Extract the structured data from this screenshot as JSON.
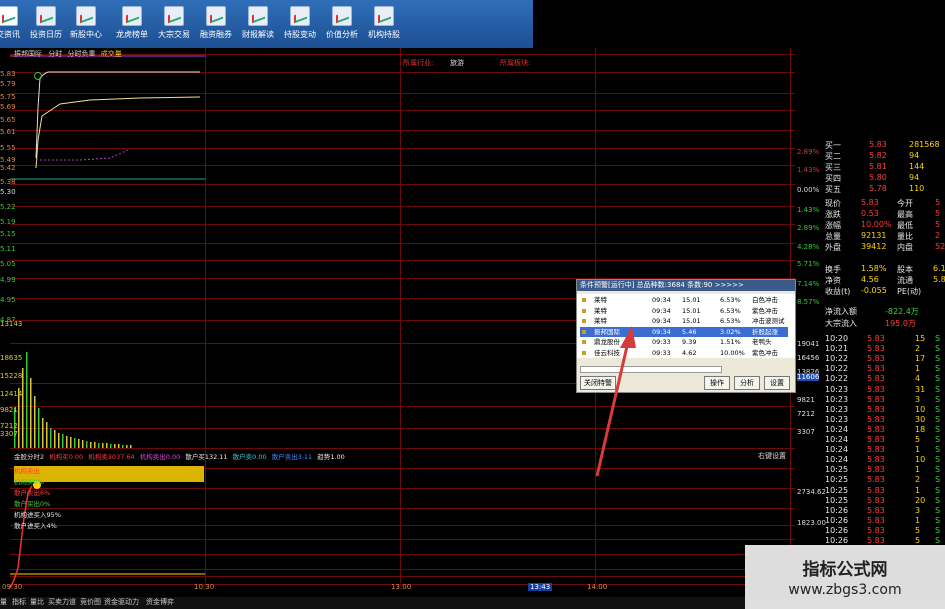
{
  "toolbar": {
    "items": [
      "交资讯",
      "投资日历",
      "新股中心",
      "龙虎榜单",
      "大宗交易",
      "融资融券",
      "财报解读",
      "持股变动",
      "价值分析",
      "机构持股"
    ]
  },
  "chart_header": {
    "stock": "振邦国际",
    "tab1": "分时",
    "tab2": "分时负重",
    "tab3": "成交量",
    "industry_label": "所属行业:",
    "industry_value": "旅游",
    "region_label": "所属板块:"
  },
  "price_axis_left": [
    "5.83",
    "5.79",
    "5.75",
    "5.69",
    "5.65",
    "5.61",
    "5.55",
    "5.49",
    "5.42",
    "5.38",
    "5.30",
    "5.22",
    "5.19",
    "5.15",
    "5.11",
    "5.05",
    "4.99",
    "4.95",
    "4.87"
  ],
  "pct_axis_right": [
    "2.89%",
    "1.43%",
    "0.00%",
    "1.43%",
    "2.89%",
    "4.28%",
    "5.71%",
    "7.14%",
    "8.57%"
  ],
  "volume_axis_left": [
    "13143",
    "18635",
    "15228",
    "12414",
    "9821",
    "7212",
    "3307"
  ],
  "volume_axis_right": [
    "19041",
    "16456",
    "13826",
    "11606",
    "9821",
    "7212",
    "3307"
  ],
  "indicator_header": {
    "name": "金股分时2",
    "fields": [
      "机构买",
      "机构卖",
      "机构卖出",
      "散户买",
      "散户卖",
      "散户卖出",
      "趋势"
    ],
    "values": [
      "0.00",
      "3037.64",
      "0.00",
      "132.11",
      "0.00",
      "3.11",
      "1.00"
    ],
    "right_label": "右键设置"
  },
  "indicator_legend": [
    "机构卖出",
    "机构买0%",
    "散户卖出6%",
    "散户买出0%",
    "机构进买入95%",
    "散户进买入4%"
  ],
  "indicator_axis": [
    "2734.62",
    "1823.00"
  ],
  "time_axis": [
    "09:30",
    "10:30",
    "13:00",
    "13:43",
    "14:00"
  ],
  "quote_panel": {
    "bids": [
      {
        "label": "买一",
        "price": "5.83",
        "vol": "281568"
      },
      {
        "label": "买二",
        "price": "5.82",
        "vol": "94"
      },
      {
        "label": "买三",
        "price": "5.81",
        "vol": "144"
      },
      {
        "label": "买四",
        "price": "5.80",
        "vol": "94"
      },
      {
        "label": "买五",
        "price": "5.78",
        "vol": "110"
      }
    ],
    "stats": [
      {
        "l1": "现价",
        "v1": "5.83",
        "l2": "今开",
        "v2": "5"
      },
      {
        "l1": "涨跌",
        "v1": "0.53",
        "l2": "最高",
        "v2": "5"
      },
      {
        "l1": "涨幅",
        "v1": "10.00%",
        "l2": "最低",
        "v2": "5"
      },
      {
        "l1": "总量",
        "v1": "92131",
        "l2": "量比",
        "v2": "2"
      },
      {
        "l1": "外盘",
        "v1": "39412",
        "l2": "内盘",
        "v2": "527"
      }
    ],
    "stats2": [
      {
        "l1": "换手",
        "v1": "1.58%",
        "l2": "股本",
        "v2": "6.1"
      },
      {
        "l1": "净资",
        "v1": "4.56",
        "l2": "流通",
        "v2": "5.8"
      },
      {
        "l1": "收益(t)",
        "v1": "-0.055",
        "l2": "PE(动)",
        "v2": ""
      }
    ],
    "flow": [
      {
        "label": "净流入额",
        "value": "-822.4万"
      },
      {
        "label": "大宗流入",
        "value": "195.0万"
      }
    ],
    "ticks": [
      {
        "t": "10:20",
        "p": "5.83",
        "v": "15",
        "s": "S"
      },
      {
        "t": "10:21",
        "p": "5.83",
        "v": "2",
        "s": "S"
      },
      {
        "t": "10:22",
        "p": "5.83",
        "v": "17",
        "s": "S"
      },
      {
        "t": "10:22",
        "p": "5.83",
        "v": "1",
        "s": "S"
      },
      {
        "t": "10:22",
        "p": "5.83",
        "v": "4",
        "s": "S"
      },
      {
        "t": "10:23",
        "p": "5.83",
        "v": "31",
        "s": "S"
      },
      {
        "t": "10:23",
        "p": "5.83",
        "v": "3",
        "s": "S"
      },
      {
        "t": "10:23",
        "p": "5.83",
        "v": "10",
        "s": "S"
      },
      {
        "t": "10:23",
        "p": "5.83",
        "v": "30",
        "s": "S"
      },
      {
        "t": "10:24",
        "p": "5.83",
        "v": "18",
        "s": "S"
      },
      {
        "t": "10:24",
        "p": "5.83",
        "v": "5",
        "s": "S"
      },
      {
        "t": "10:24",
        "p": "5.83",
        "v": "1",
        "s": "S"
      },
      {
        "t": "10:24",
        "p": "5.83",
        "v": "10",
        "s": "S"
      },
      {
        "t": "10:25",
        "p": "5.83",
        "v": "1",
        "s": "S"
      },
      {
        "t": "10:25",
        "p": "5.83",
        "v": "2",
        "s": "S"
      },
      {
        "t": "10:25",
        "p": "5.83",
        "v": "1",
        "s": "S"
      },
      {
        "t": "10:25",
        "p": "5.83",
        "v": "20",
        "s": "S"
      },
      {
        "t": "10:26",
        "p": "5.83",
        "v": "3",
        "s": "S"
      },
      {
        "t": "10:26",
        "p": "5.83",
        "v": "1",
        "s": "S"
      },
      {
        "t": "10:26",
        "p": "5.83",
        "v": "5",
        "s": "S"
      },
      {
        "t": "10:26",
        "p": "5.83",
        "v": "5",
        "s": "S"
      }
    ]
  },
  "popup": {
    "title": "条件预警[运行中] 总品种数:3684 条数:90 >>>>>",
    "rows": [
      {
        "name": "莱特",
        "time": "09:34",
        "price": "15.01",
        "pct": "6.53%",
        "cond": "白色冲击"
      },
      {
        "name": "莱特",
        "time": "09:34",
        "price": "15.01",
        "pct": "6.53%",
        "cond": "紫色冲击"
      },
      {
        "name": "莱特",
        "time": "09:34",
        "price": "15.01",
        "pct": "6.53%",
        "cond": "冲击波测试"
      },
      {
        "name": "振邦国际",
        "time": "09:34",
        "price": "5.46",
        "pct": "3.02%",
        "cond": "折股起涨"
      },
      {
        "name": "鼎龙股份",
        "time": "09:33",
        "price": "9.39",
        "pct": "1.51%",
        "cond": "老鸭头"
      },
      {
        "name": "佳云科技",
        "time": "09:33",
        "price": "4.62",
        "pct": "10.00%",
        "cond": "紫色冲击"
      }
    ],
    "close_btn": "关闭特警",
    "btn_op": "操作",
    "btn_analyze": "分析",
    "btn_settings": "设置"
  },
  "bottom_tabs": [
    "量",
    "指标",
    "量比",
    "买卖力道",
    "竞价图",
    "资金驱动力",
    "资金博弈"
  ],
  "watermark": {
    "title": "指标公式网",
    "url": "www.zbgs3.com"
  },
  "colors": {
    "red": "#ff3b3b",
    "green": "#3fd13f",
    "grid": "#6b0a0a",
    "accent": "#3a6ed0"
  }
}
